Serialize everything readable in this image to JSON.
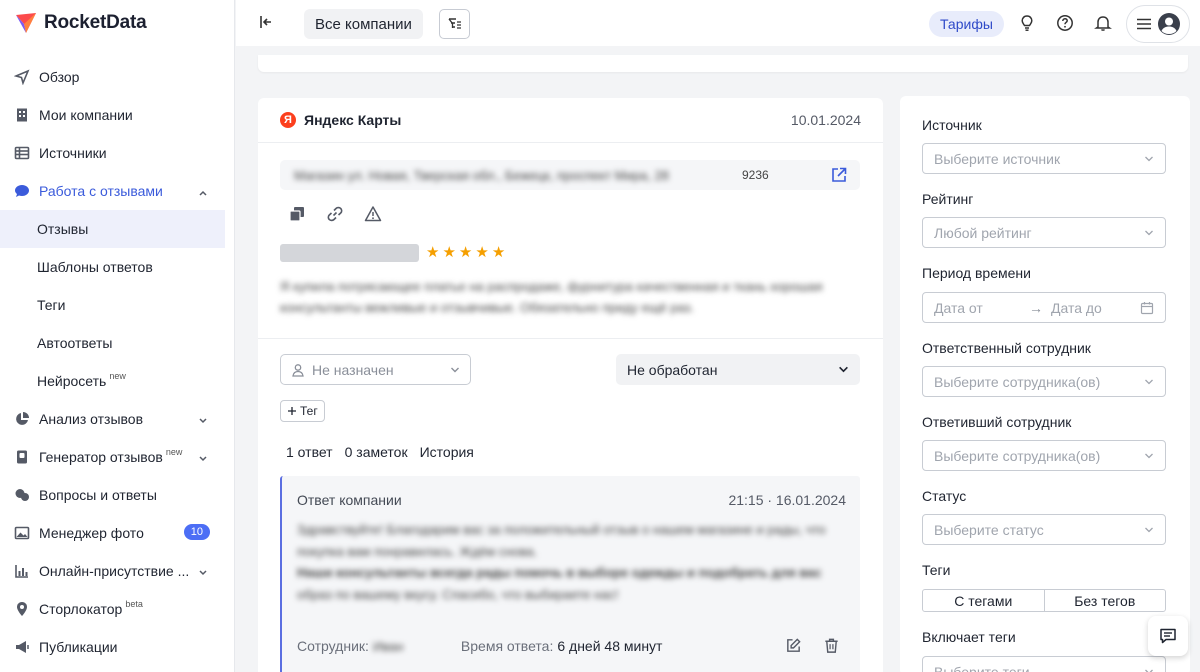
{
  "app": {
    "name": "RocketData",
    "brand_color": "#3b5bdb"
  },
  "sidebar": {
    "items": [
      {
        "label": "Обзор",
        "icon": "send-icon"
      },
      {
        "label": "Мои компании",
        "icon": "building-icon"
      },
      {
        "label": "Источники",
        "icon": "table-icon"
      },
      {
        "label": "Работа с отзывами",
        "icon": "chat-bubble-icon"
      },
      {
        "label": "Анализ отзывов",
        "icon": "pie-chart-icon"
      },
      {
        "label": "Генератор отзывов",
        "icon": "badge-icon",
        "sup": "new"
      },
      {
        "label": "Вопросы и ответы",
        "icon": "chats-icon"
      },
      {
        "label": "Менеджер фото",
        "icon": "image-icon",
        "badge": "10"
      },
      {
        "label": "Онлайн-присутствие ...",
        "icon": "bar-chart-icon"
      },
      {
        "label": "Сторлокатор",
        "icon": "map-pin-icon",
        "sup": "beta"
      },
      {
        "label": "Публикации",
        "icon": "megaphone-icon"
      }
    ],
    "subitems": [
      {
        "label": "Отзывы",
        "selected": true
      },
      {
        "label": "Шаблоны ответов"
      },
      {
        "label": "Теги"
      },
      {
        "label": "Автоответы"
      },
      {
        "label": "Нейросеть",
        "sup": "new"
      }
    ]
  },
  "topbar": {
    "company_selector": "Все компании",
    "tariff": "Тарифы"
  },
  "review": {
    "source": "Яндекс Карты",
    "source_logo_letter": "Я",
    "date": "10.01.2024",
    "address_blurred": "Магазин ул. Новая, Тверская обл., Бежецк, проспект Мира, 28",
    "address_code": "9236",
    "rating": 5,
    "text_blurred_1": "Я купила потрясающее платье на распродаже, фурнитура качественная и ткань хорошая",
    "text_blurred_2": "консультанты вежливые и отзывчивые. Обязательно приду ещё раз.",
    "assignee_placeholder": "Не назначен",
    "status": "Не обработан",
    "tag_button": "Тег",
    "tabs": [
      "1 ответ",
      "0 заметок",
      "История"
    ]
  },
  "answer": {
    "title": "Ответ компании",
    "time": "21:15 · 16.01.2024",
    "text_blurred": [
      "Здравствуйте! Благодарим вас за положительный отзыв о нашем магазине и рады, что",
      "покупка вам понравилась. Ждём снова.",
      "Наши консультанты всегда рады помочь в выборе одежды и подобрать для вас",
      "образ по вашему вкусу. Спасибо, что выбираете нас!"
    ],
    "employee_label": "Сотрудник:",
    "employee_blurred": "Иван",
    "response_time_label": "Время ответа:",
    "response_time_value": "6 дней 48 минут"
  },
  "filters": {
    "source": {
      "label": "Источник",
      "placeholder": "Выберите источник"
    },
    "rating": {
      "label": "Рейтинг",
      "placeholder": "Любой рейтинг"
    },
    "period": {
      "label": "Период времени",
      "from": "Дата от",
      "arrow": "→",
      "to": "Дата до"
    },
    "responsible": {
      "label": "Ответственный сотрудник",
      "placeholder": "Выберите сотрудника(ов)"
    },
    "responder": {
      "label": "Ответивший сотрудник",
      "placeholder": "Выберите сотрудника(ов)"
    },
    "status": {
      "label": "Статус",
      "placeholder": "Выберите статус"
    },
    "tags": {
      "label": "Теги",
      "with": "С тегами",
      "without": "Без тегов"
    },
    "includes_tags": {
      "label": "Включает теги",
      "placeholder": "Выберите теги"
    }
  }
}
